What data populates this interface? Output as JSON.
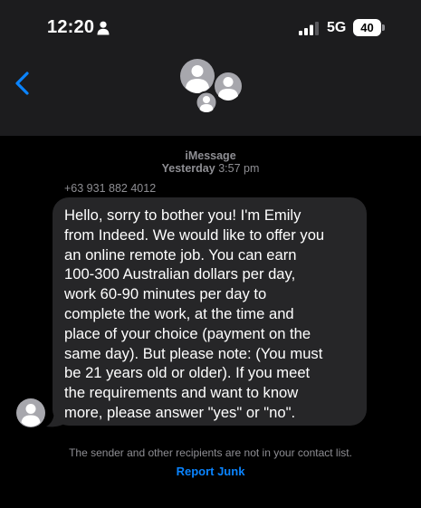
{
  "status_bar": {
    "time": "12:20",
    "network": "5G",
    "battery": "40",
    "icons": [
      "person-icon",
      "signal-bars-icon"
    ]
  },
  "header": {
    "back_icon": "chevron-left-icon",
    "avatar_icon": "group-avatar-icon",
    "accent_color": "#0a84ff"
  },
  "conversation": {
    "service": "iMessage",
    "timestamp_day": "Yesterday",
    "timestamp_time": "3:57 pm",
    "sender": "+63 931 882 4012",
    "message": "Hello, sorry to bother you! I'm Emily\nfrom Indeed. We would like to offer you\nan online remote job. You can earn\n100-300 Australian dollars per day,\nwork 60-90 minutes per day to\ncomplete the work, at the time and\nplace of your choice (payment on the\nsame day). But please note: (You must\nbe 21 years old or older). If you meet\nthe requirements and want to know\nmore, please answer \"yes\" or \"no\".",
    "bubble_color": "#262628"
  },
  "footer": {
    "notice": "The sender and other recipients are not in your contact list.",
    "report_junk": "Report Junk"
  }
}
